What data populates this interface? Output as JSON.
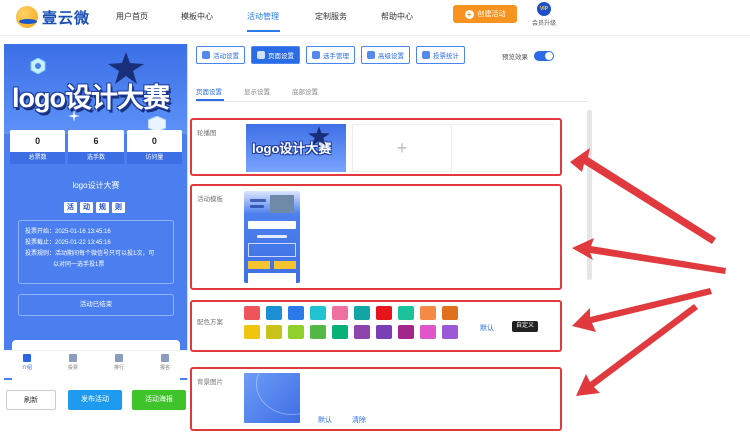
{
  "brand": {
    "name": "壹云微"
  },
  "nav": {
    "items": [
      {
        "label": "用户首页",
        "active": false
      },
      {
        "label": "模板中心",
        "active": false
      },
      {
        "label": "活动管理",
        "active": true
      },
      {
        "label": "定制服务",
        "active": false
      },
      {
        "label": "帮助中心",
        "active": false
      }
    ],
    "create_label": "创建活动",
    "vip_badge": "VIP",
    "vip_label": "会员升级"
  },
  "preview": {
    "banner_title": "logo设计大赛",
    "stats": [
      {
        "num": "0",
        "label": "总票数"
      },
      {
        "num": "6",
        "label": "选手数"
      },
      {
        "num": "0",
        "label": "访问量"
      }
    ],
    "activity_title": "logo设计大赛",
    "rules_chars": [
      "活",
      "动",
      "规",
      "则"
    ],
    "vote_start": "投票开始：2025-01-16 13:45:16",
    "vote_end": "投票截止：2025-01-22 13:45:16",
    "vote_rule_1": "投票规则：活动期间每个微信号只可以投1次，可",
    "vote_rule_2": "以对同一选手投1票",
    "ended": "活动已结束",
    "tabs": [
      "介绍",
      "投票",
      "排行",
      "报名"
    ]
  },
  "actions": {
    "refresh": "刷新",
    "publish": "发布活动",
    "poster": "活动海报"
  },
  "toolbar": {
    "buttons": [
      "活动设置",
      "页面设置",
      "选手管理",
      "高级设置",
      "投票统计"
    ],
    "preview_label": "预览效果"
  },
  "subtabs": [
    "页面设置",
    "显示设置",
    "底部设置"
  ],
  "sections": {
    "carousel": {
      "label": "轮播图",
      "image_title": "logo设计大赛",
      "add": "+"
    },
    "template": {
      "label": "活动模板"
    },
    "colors": {
      "label": "配色方案",
      "swatches": [
        "#f0545b",
        "#1d8fd6",
        "#2a7be9",
        "#22c3d1",
        "#ef6fa0",
        "#12a5a5",
        "#e8141b",
        "#1cc29b",
        "#f58a46",
        "#e1701e",
        "#f1c40f",
        "#c9c21a",
        "#8fd02d",
        "#53b845",
        "#08b277",
        "#8e44ad",
        "#7b3fb5",
        "#a3268d",
        "#e055c9",
        "#9b59d6"
      ],
      "default_label": "默认",
      "custom_label": "自定义"
    },
    "background": {
      "label": "背景图片",
      "default_label": "默认",
      "clear_label": "清除"
    }
  },
  "colors": {
    "accent": "#2a6be6",
    "orange": "#f7931e",
    "highlight": "#e0393e"
  }
}
